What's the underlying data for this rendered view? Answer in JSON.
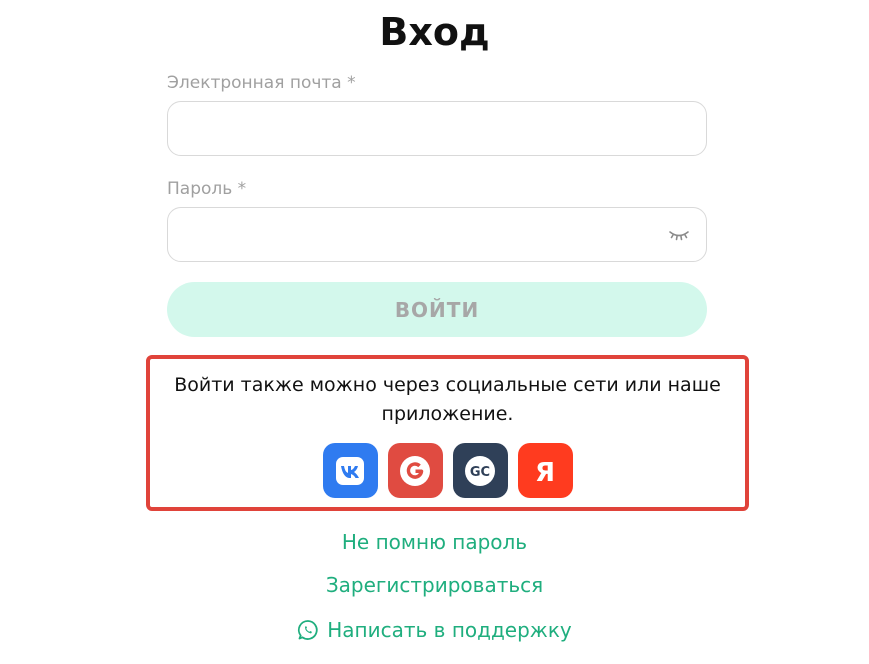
{
  "page": {
    "title": "Вход"
  },
  "form": {
    "email_label": "Электронная почта *",
    "email_value": "",
    "password_label": "Пароль *",
    "password_value": "",
    "login_label": "ВОЙТИ"
  },
  "social": {
    "text": "Войти также можно через социальные сети или наше приложение.",
    "buttons": [
      {
        "name": "vk",
        "label": "VK",
        "color": "#2f7bf0",
        "icon": "vk-icon"
      },
      {
        "name": "google",
        "label": "G",
        "color": "#e04b41",
        "icon": "google-icon"
      },
      {
        "name": "getcourse",
        "label": "GC",
        "color": "#2f4058",
        "icon": "getcourse-icon"
      },
      {
        "name": "yandex",
        "label": "Я",
        "color": "#ff3b1f",
        "icon": "yandex-icon"
      }
    ],
    "border_color": "#e0433a"
  },
  "links": {
    "forgot": "Не помню пароль",
    "register": "Зарегистрироваться",
    "support": "Написать в поддержку"
  },
  "colors": {
    "accent": "#1fae7e",
    "button_bg": "#d3f8ec",
    "button_text": "#a7a7a7"
  }
}
